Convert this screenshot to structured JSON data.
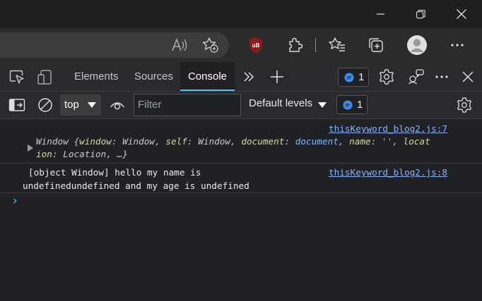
{
  "window": {
    "controls": [
      "minimize",
      "restore",
      "close"
    ]
  },
  "browser": {
    "icons": [
      "read-aloud-icon",
      "add-favorite-icon",
      "ublock-icon",
      "extensions-icon",
      "favorites-icon",
      "collections-icon",
      "profile-icon",
      "more-icon"
    ],
    "ublock_label": "uB"
  },
  "devtools": {
    "tabs": [
      {
        "label": "Elements",
        "active": false
      },
      {
        "label": "Sources",
        "active": false
      },
      {
        "label": "Console",
        "active": true
      }
    ],
    "issues_count": "1",
    "accent": "#4fc3f7"
  },
  "console_toolbar": {
    "context": "top",
    "filter_placeholder": "Filter",
    "levels": "Default levels",
    "issues_count": "1"
  },
  "messages": [
    {
      "source": "thisKeyword_blog2.js:7",
      "preview_line1": {
        "head": "Window {",
        "p1": "window",
        "v1": "Window",
        "p2": "self",
        "v2": "Window",
        "p3": "document",
        "v3": "document",
        "p4": "name",
        "v4": "''",
        "p5_start": "locat"
      },
      "preview_line2": {
        "p5_end": "ion",
        "v5": "Location",
        "tail": "…}"
      }
    },
    {
      "source": "thisKeyword_blog2.js:8",
      "line1": "[object Window] hello my name is",
      "line2": "undefinedundefined and my age is undefined"
    }
  ],
  "prompt_symbol": "›"
}
